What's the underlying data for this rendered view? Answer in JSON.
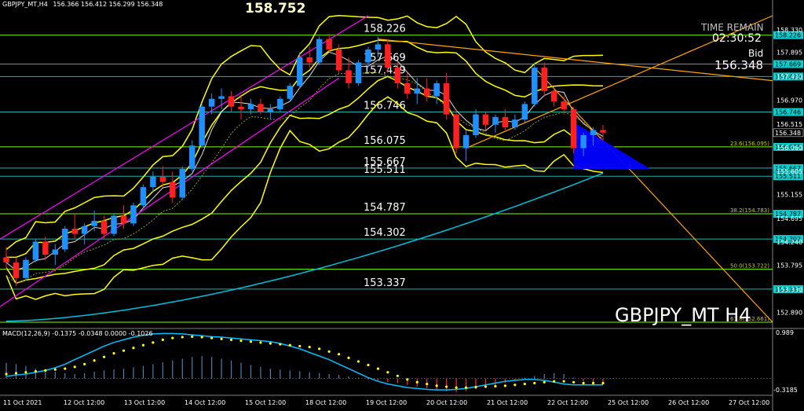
{
  "header": {
    "symbol_line": "GBPJPY_MT,H4",
    "ohlc": "156.366 156.412 156.299 156.348"
  },
  "info": {
    "time_remain_label": "TIME REMAIN",
    "time_remain": "02:30:52",
    "bid_label": "Bid",
    "bid": "156.348",
    "top_price": "158.752",
    "watermark": "GBPJPY_MT H4"
  },
  "macd": {
    "label": "MACD(12,26,9) -0.1375 -0.0348 0.0000 -0.1026",
    "axis_top": "0.989",
    "axis_bottom": "-0.3185"
  },
  "colors": {
    "background": "#000000",
    "bull_candle": "#1e90ff",
    "bear_candle": "#ff2020",
    "level_line": "#7cfc00",
    "level_line_alt": "#20b2aa",
    "bollinger": "#ffff00",
    "channel": "#ff00ff",
    "trendline": "#ffa500",
    "ma_cyan": "#00bfd8",
    "triangle": "#0000ff",
    "macd_signal": "#ffff00",
    "macd_line": "#00bfff"
  },
  "chart_data": {
    "type": "candlestick",
    "instrument": "GBPJPY_MT",
    "timeframe": "H4",
    "x_labels": [
      "11 Oct 2021",
      "12 Oct 12:00",
      "13 Oct 12:00",
      "14 Oct 12:00",
      "15 Oct 12:00",
      "18 Oct 12:00",
      "19 Oct 12:00",
      "20 Oct 12:00",
      "21 Oct 12:00",
      "22 Oct 12:00",
      "25 Oct 12:00",
      "26 Oct 12:00",
      "27 Oct 12:00"
    ],
    "y_ticks": [
      "158.330",
      "157.895",
      "157.430",
      "156.970",
      "156.515",
      "156.060",
      "155.605",
      "155.155",
      "154.695",
      "154.240",
      "153.795",
      "153.330",
      "152.890"
    ],
    "ylim": [
      152.7,
      158.6
    ],
    "levels": [
      {
        "value": 158.226,
        "label": "158.226",
        "right_tag": "158.226",
        "color": "#7cfc00"
      },
      {
        "value": 157.669,
        "label": "157.669",
        "right_tag": "157.669",
        "color": "#20b2aa"
      },
      {
        "value": 157.429,
        "label": "157.429",
        "right_tag": "157.429",
        "color": "#20b2aa"
      },
      {
        "value": 156.746,
        "label": "156.746",
        "right_tag": "156.746",
        "color": "#20b2aa"
      },
      {
        "value": 156.075,
        "label": "156.075",
        "right_tag": "156.075",
        "color": "#7cfc00",
        "fib": "23.6(156.095)"
      },
      {
        "value": 155.667,
        "label": "155.667",
        "right_tag": "155.667",
        "color": "#20b2aa"
      },
      {
        "value": 155.511,
        "label": "155.511",
        "right_tag": "155.511",
        "color": "#20b2aa"
      },
      {
        "value": 154.787,
        "label": "154.787",
        "right_tag": "154.787",
        "color": "#7cfc00",
        "fib": "38.2(154.783)"
      },
      {
        "value": 154.302,
        "label": "154.302",
        "right_tag": "154.302",
        "color": "#20b2aa"
      },
      {
        "value": 153.72,
        "label": "",
        "right_tag": "",
        "color": "#7cfc00",
        "fib": "50.0(153.722)"
      },
      {
        "value": 153.337,
        "label": "153.337",
        "right_tag": "153.337",
        "color": "#20b2aa"
      },
      {
        "value": 152.7,
        "label": "",
        "right_tag": "",
        "color": "#7cfc00",
        "fib": "61.8(152.661)"
      }
    ],
    "current_price_tag": "156.348",
    "candles": [
      [
        153.95,
        154.15,
        153.7,
        153.85
      ],
      [
        153.85,
        153.95,
        153.4,
        153.55
      ],
      [
        153.55,
        153.95,
        153.5,
        153.9
      ],
      [
        153.9,
        154.3,
        153.85,
        154.25
      ],
      [
        154.25,
        154.35,
        153.9,
        154.0
      ],
      [
        154.0,
        154.2,
        153.8,
        154.1
      ],
      [
        154.1,
        154.55,
        154.05,
        154.5
      ],
      [
        154.5,
        154.8,
        154.3,
        154.4
      ],
      [
        154.4,
        154.6,
        154.2,
        154.55
      ],
      [
        154.55,
        154.85,
        154.45,
        154.65
      ],
      [
        154.65,
        154.75,
        154.3,
        154.4
      ],
      [
        154.4,
        154.8,
        154.35,
        154.75
      ],
      [
        154.75,
        154.95,
        154.5,
        154.6
      ],
      [
        154.6,
        155.0,
        154.55,
        154.95
      ],
      [
        154.95,
        155.35,
        154.9,
        155.3
      ],
      [
        155.3,
        155.6,
        155.2,
        155.5
      ],
      [
        155.5,
        155.7,
        155.3,
        155.4
      ],
      [
        155.4,
        155.6,
        155.0,
        155.1
      ],
      [
        155.1,
        155.7,
        155.05,
        155.65
      ],
      [
        155.65,
        156.2,
        155.6,
        156.1
      ],
      [
        156.1,
        156.9,
        156.05,
        156.85
      ],
      [
        156.85,
        157.1,
        156.7,
        157.0
      ],
      [
        157.0,
        157.2,
        156.8,
        157.05
      ],
      [
        157.05,
        157.15,
        156.75,
        156.85
      ],
      [
        156.85,
        157.05,
        156.6,
        156.8
      ],
      [
        156.8,
        157.0,
        156.7,
        156.9
      ],
      [
        156.9,
        157.0,
        156.7,
        156.75
      ],
      [
        156.75,
        156.9,
        156.6,
        156.8
      ],
      [
        156.8,
        157.05,
        156.75,
        157.0
      ],
      [
        157.0,
        157.3,
        156.95,
        157.25
      ],
      [
        157.25,
        157.9,
        157.2,
        157.8
      ],
      [
        157.8,
        158.0,
        157.6,
        157.7
      ],
      [
        157.7,
        158.2,
        157.65,
        158.15
      ],
      [
        158.15,
        158.25,
        157.9,
        157.95
      ],
      [
        157.95,
        158.05,
        157.5,
        157.55
      ],
      [
        157.55,
        157.8,
        157.2,
        157.3
      ],
      [
        157.3,
        157.75,
        157.25,
        157.7
      ],
      [
        157.7,
        158.0,
        157.6,
        157.95
      ],
      [
        157.95,
        158.2,
        157.8,
        158.05
      ],
      [
        158.05,
        158.15,
        157.5,
        157.6
      ],
      [
        157.6,
        157.7,
        157.2,
        157.3
      ],
      [
        157.3,
        157.5,
        157.0,
        157.1
      ],
      [
        157.1,
        157.4,
        156.9,
        157.2
      ],
      [
        157.2,
        157.4,
        156.95,
        157.05
      ],
      [
        157.05,
        157.35,
        156.9,
        157.3
      ],
      [
        157.3,
        157.5,
        156.6,
        156.7
      ],
      [
        156.7,
        156.8,
        155.95,
        156.05
      ],
      [
        156.05,
        156.4,
        155.8,
        156.3
      ],
      [
        156.3,
        156.8,
        156.25,
        156.7
      ],
      [
        156.7,
        156.75,
        156.4,
        156.5
      ],
      [
        156.5,
        156.7,
        156.35,
        156.65
      ],
      [
        156.65,
        156.8,
        156.4,
        156.45
      ],
      [
        156.45,
        156.7,
        156.4,
        156.6
      ],
      [
        156.6,
        156.95,
        156.55,
        156.9
      ],
      [
        156.9,
        157.7,
        156.85,
        157.6
      ],
      [
        157.6,
        157.7,
        157.05,
        157.15
      ],
      [
        157.15,
        157.2,
        156.85,
        156.95
      ],
      [
        156.95,
        157.05,
        156.7,
        156.8
      ],
      [
        156.8,
        156.85,
        155.95,
        156.05
      ],
      [
        156.05,
        156.35,
        155.9,
        156.3
      ],
      [
        156.3,
        156.45,
        156.1,
        156.4
      ],
      [
        156.4,
        156.5,
        156.2,
        156.35
      ]
    ],
    "macd_histogram": [
      0.35,
      0.32,
      0.28,
      0.22,
      0.18,
      0.15,
      0.12,
      0.1,
      0.12,
      0.15,
      0.18,
      0.2,
      0.22,
      0.25,
      0.28,
      0.32,
      0.36,
      0.4,
      0.44,
      0.48,
      0.5,
      0.48,
      0.44,
      0.4,
      0.35,
      0.3,
      0.26,
      0.22,
      0.2,
      0.18,
      0.16,
      0.14,
      0.12,
      0.1,
      0.08,
      0.05,
      0.02,
      -0.02,
      -0.05,
      -0.08,
      -0.1,
      -0.14,
      -0.18,
      -0.22,
      -0.26,
      -0.28,
      -0.3,
      -0.28,
      -0.24,
      -0.2,
      -0.16,
      -0.1,
      -0.05,
      0.02,
      0.06,
      0.1,
      0.12,
      0.1,
      0.02,
      -0.06,
      -0.1,
      -0.1
    ],
    "macd_signal": [
      0.1,
      0.12,
      0.14,
      0.16,
      0.18,
      0.2,
      0.22,
      0.26,
      0.32,
      0.4,
      0.48,
      0.56,
      0.62,
      0.68,
      0.74,
      0.8,
      0.86,
      0.9,
      0.92,
      0.93,
      0.92,
      0.9,
      0.88,
      0.86,
      0.84,
      0.82,
      0.8,
      0.78,
      0.76,
      0.74,
      0.72,
      0.7,
      0.66,
      0.6,
      0.54,
      0.46,
      0.38,
      0.3,
      0.22,
      0.14,
      0.06,
      -0.02,
      -0.08,
      -0.12,
      -0.16,
      -0.18,
      -0.2,
      -0.2,
      -0.19,
      -0.18,
      -0.17,
      -0.16,
      -0.14,
      -0.12,
      -0.1,
      -0.08,
      -0.06,
      -0.06,
      -0.08,
      -0.1,
      -0.1,
      -0.1
    ],
    "macd_line": [
      0.05,
      0.08,
      0.1,
      0.14,
      0.18,
      0.24,
      0.32,
      0.42,
      0.52,
      0.62,
      0.72,
      0.8,
      0.86,
      0.92,
      0.96,
      0.99,
      1.0,
      1.0,
      0.99,
      0.97,
      0.95,
      0.93,
      0.92,
      0.9,
      0.88,
      0.86,
      0.84,
      0.82,
      0.78,
      0.72,
      0.66,
      0.58,
      0.5,
      0.42,
      0.32,
      0.22,
      0.12,
      0.02,
      -0.06,
      -0.12,
      -0.16,
      -0.2,
      -0.22,
      -0.24,
      -0.25,
      -0.25,
      -0.24,
      -0.22,
      -0.18,
      -0.14,
      -0.1,
      -0.06,
      -0.04,
      -0.02,
      -0.02,
      -0.04,
      -0.08,
      -0.12,
      -0.14,
      -0.14,
      -0.14,
      -0.14
    ],
    "macd_range": [
      -0.3185,
      0.989
    ]
  }
}
